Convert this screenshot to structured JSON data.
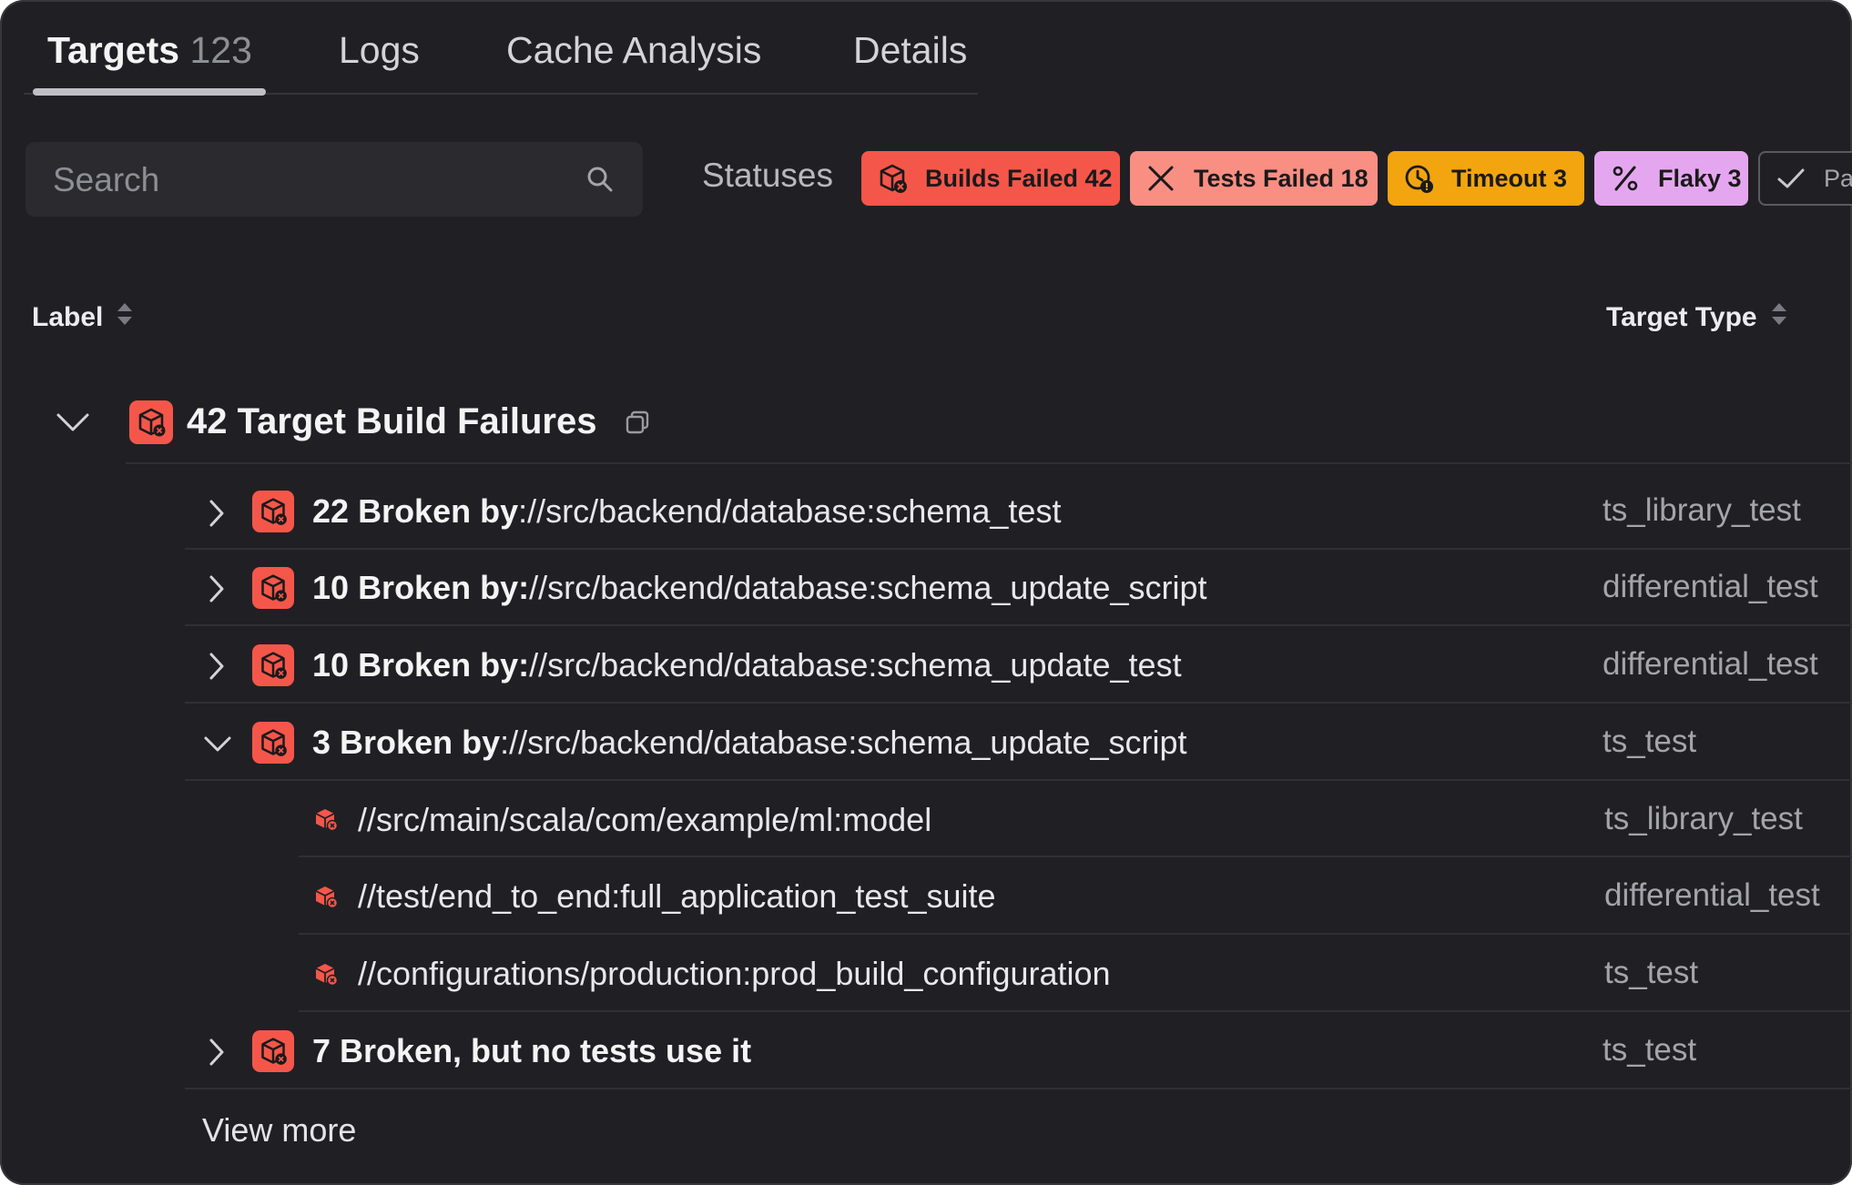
{
  "tabs": [
    {
      "label": "Targets",
      "count": "123"
    },
    {
      "label": "Logs"
    },
    {
      "label": "Cache Analysis"
    },
    {
      "label": "Details"
    }
  ],
  "search": {
    "placeholder": "Search"
  },
  "filters": {
    "label": "Statuses",
    "chips": [
      {
        "label": "Builds Failed 42",
        "color": "#f5564a"
      },
      {
        "label": "Tests Failed 18",
        "color": "#f98e83"
      },
      {
        "label": "Timeout 3",
        "color": "#f2a50f"
      },
      {
        "label": "Flaky 3",
        "color": "#e5a6f0"
      },
      {
        "label": "Pa",
        "color": "#202024"
      }
    ]
  },
  "table": {
    "columns": {
      "label": "Label",
      "target_type": "Target Type"
    },
    "group": {
      "title": "42 Target Build Failures",
      "icon": "broken-build-icon",
      "action_icon": "copy-icon"
    },
    "rows": [
      {
        "count": "22",
        "broken_by": "Broken by",
        "path": "://src/backend/database:schema_test",
        "type": "ts_library_test",
        "expanded": false
      },
      {
        "count": "10",
        "broken_by": "Broken by:",
        "path": "//src/backend/database:schema_update_script",
        "type": "differential_test",
        "expanded": false
      },
      {
        "count": "10",
        "broken_by": "Broken by:",
        "path": "//src/backend/database:schema_update_test",
        "type": "differential_test",
        "expanded": false
      },
      {
        "count": "3",
        "broken_by": "Broken by",
        "path": "://src/backend/database:schema_update_script",
        "type": "ts_test",
        "expanded": true
      }
    ],
    "children": [
      {
        "path": "//src/main/scala/com/example/ml:model",
        "type": "ts_library_test"
      },
      {
        "path": "//test/end_to_end:full_application_test_suite",
        "type": "differential_test"
      },
      {
        "path": "//configurations/production:prod_build_configuration",
        "type": "ts_test"
      }
    ],
    "last_row": {
      "label": "7 Broken, but no tests use it",
      "type": "ts_test"
    },
    "view_more": "View more"
  }
}
